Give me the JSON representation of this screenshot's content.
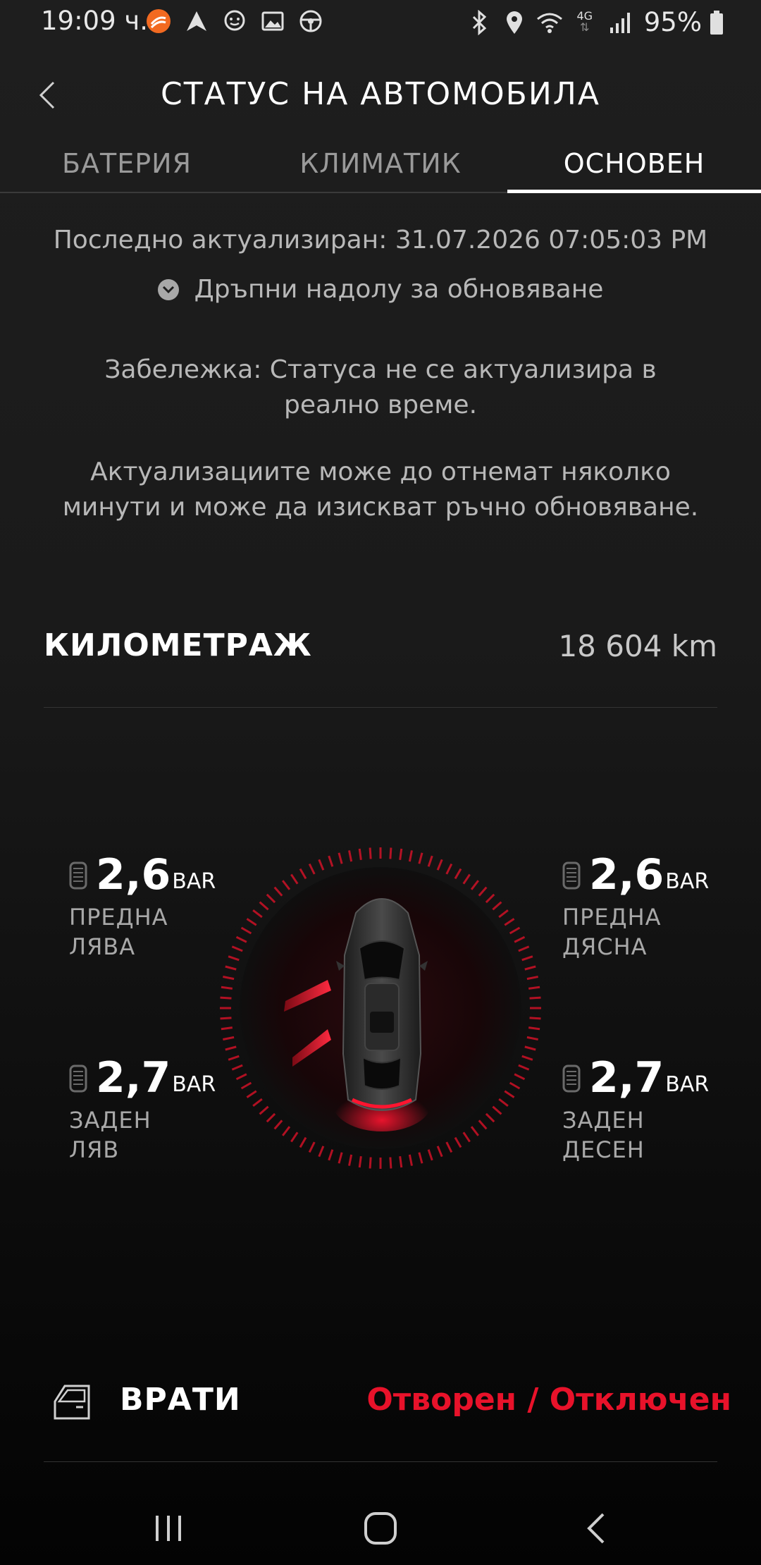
{
  "status_bar": {
    "time": "19:09 ч.",
    "battery": "95%",
    "icons_left": [
      "app-icon",
      "navigation-icon",
      "waze-icon",
      "gallery-icon",
      "steering-wheel-icon"
    ],
    "icons_right": [
      "bluetooth-icon",
      "location-icon",
      "wifi-icon",
      "4g-icon",
      "signal-icon",
      "battery-icon"
    ],
    "network": "4G"
  },
  "header": {
    "title": "СТАТУС НА АВТОМОБИЛА"
  },
  "tabs": [
    {
      "label": "БАТЕРИЯ",
      "active": false
    },
    {
      "label": "КЛИМАТИК",
      "active": false
    },
    {
      "label": "ОСНОВЕН",
      "active": true
    }
  ],
  "info": {
    "last_updated": "Последно актуализиран: 31.07.2026 07:05:03 PM",
    "pull_hint": "Дръпни надолу за обновяване",
    "note1": "Забележка: Статуса не се актуализира в реално време.",
    "note2": "Актуализациите може до отнемат няколко минути и може да изискват ръчно обновяване."
  },
  "mileage": {
    "label": "КИЛОМЕТРАЖ",
    "value": "18 604 km"
  },
  "tires": {
    "unit": "BAR",
    "front_left": {
      "value": "2,6",
      "label_line1": "ПРЕДНА",
      "label_line2": "ЛЯВА"
    },
    "front_right": {
      "value": "2,6",
      "label_line1": "ПРЕДНА",
      "label_line2": "ДЯСНА"
    },
    "rear_left": {
      "value": "2,7",
      "label_line1": "ЗАДЕН",
      "label_line2": "ЛЯВ"
    },
    "rear_right": {
      "value": "2,7",
      "label_line1": "ЗАДЕН",
      "label_line2": "ДЕСЕН"
    }
  },
  "doors": {
    "label": "ВРАТИ",
    "status": "Отворен / Отключен",
    "status_color": "#e8122a"
  },
  "colors": {
    "accent_red": "#e8122a",
    "background": "#1e1e1e"
  }
}
